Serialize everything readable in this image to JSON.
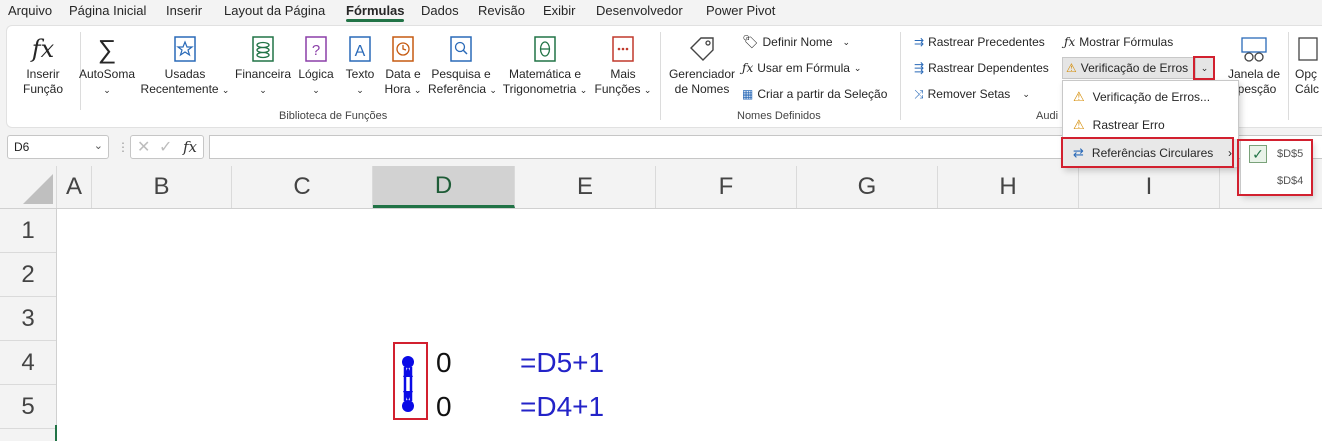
{
  "menu": {
    "items": [
      "Arquivo",
      "Página Inicial",
      "Inserir",
      "Layout da Página",
      "Fórmulas",
      "Dados",
      "Revisão",
      "Exibir",
      "Desenvolvedor",
      "Power Pivot"
    ],
    "active": "Fórmulas"
  },
  "ribbon": {
    "insert_function": [
      "Inserir",
      "Função"
    ],
    "autosum": "AutoSoma",
    "recent": [
      "Usadas",
      "Recentemente"
    ],
    "financial": "Financeira",
    "logical": "Lógica",
    "text": "Texto",
    "datetime": [
      "Data e",
      "Hora"
    ],
    "lookup": [
      "Pesquisa e",
      "Referência"
    ],
    "math": [
      "Matemática e",
      "Trigonometria"
    ],
    "more": [
      "Mais",
      "Funções"
    ],
    "library_label": "Biblioteca de Funções",
    "name_manager": [
      "Gerenciador",
      "de Nomes"
    ],
    "define_name": "Definir Nome",
    "use_in_formula": "Usar em Fórmula",
    "create_from_selection": "Criar a partir da Seleção",
    "defined_names_label": "Nomes Definidos",
    "trace_precedents": "Rastrear Precedentes",
    "trace_dependents": "Rastrear Dependentes",
    "remove_arrows": "Remover Setas",
    "show_formulas": "Mostrar Fórmulas",
    "error_checking": "Verificação de Erros",
    "auditing_label_partial": "Audi",
    "watch_window": [
      "Janela de",
      "spesção"
    ],
    "calc_options": [
      "Opç",
      "Cálc"
    ]
  },
  "formula_bar": {
    "name_box": "D6",
    "fx": "fx",
    "formula": ""
  },
  "grid": {
    "columns": [
      "A",
      "B",
      "C",
      "D",
      "E",
      "F",
      "G",
      "H",
      "I"
    ],
    "selected_column": "D",
    "rows": [
      "1",
      "2",
      "3",
      "4",
      "5"
    ],
    "cells": {
      "D4": "0",
      "D5": "0",
      "E4": "=D5+1",
      "E5": "=D4+1"
    }
  },
  "dropdown": {
    "items": [
      "Verificação de Erros...",
      "Rastrear Erro",
      "Referências Circulares"
    ],
    "highlighted": "Referências Circulares",
    "submenu": [
      "$D$5",
      "$D$4"
    ]
  },
  "colors": {
    "accent": "#217346",
    "highlight_red": "#d2202f",
    "formula_blue": "#2323c8",
    "arrow_blue": "#0a0ae6"
  }
}
